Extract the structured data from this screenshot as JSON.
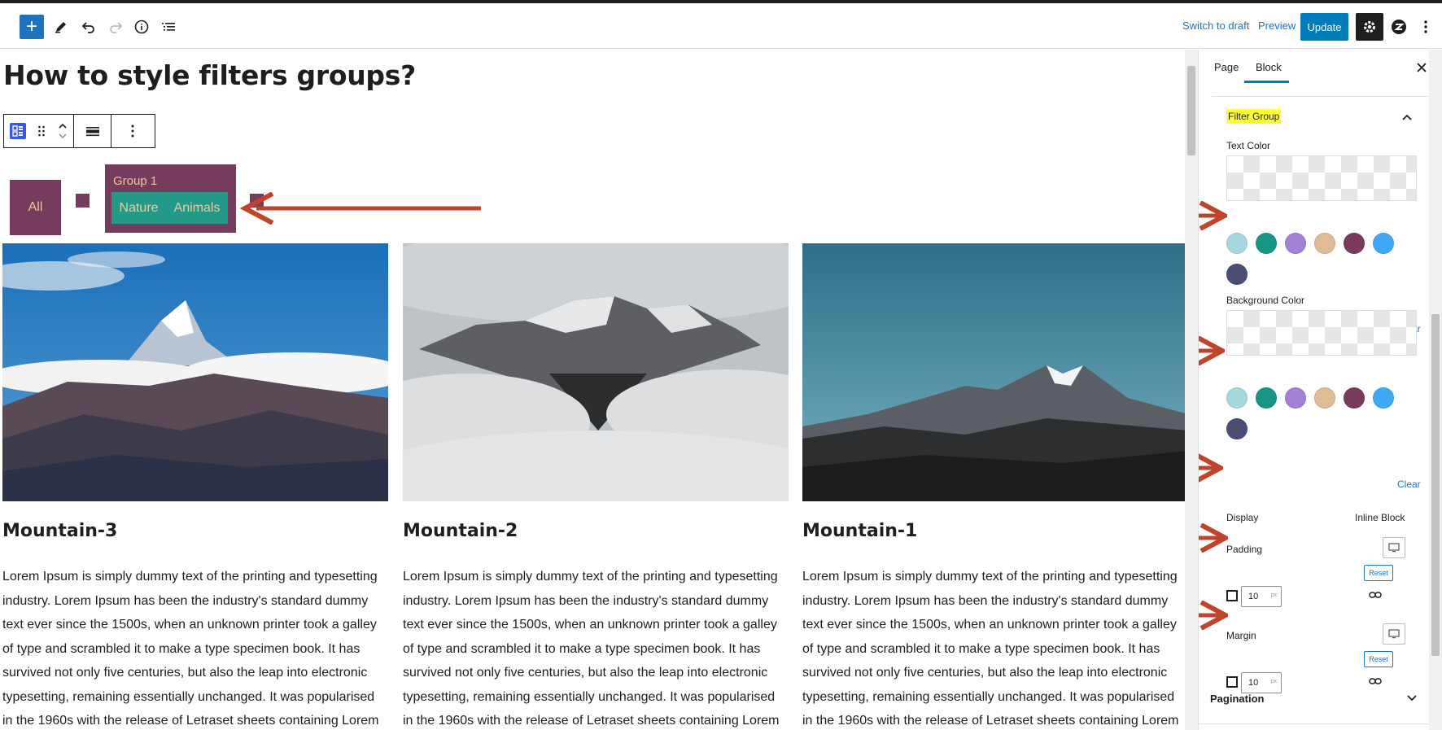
{
  "topbar": {
    "add_label": "+",
    "switch_to_draft": "Switch to draft",
    "preview": "Preview",
    "update": "Update"
  },
  "editor": {
    "page_title": "How to style filters groups?",
    "filters": {
      "all": "All",
      "group_title": "Group 1",
      "items": [
        "Nature",
        "Animals"
      ]
    },
    "cards": [
      {
        "title": "Mountain-3",
        "text": "Lorem Ipsum is simply dummy text of the printing and typesetting industry. Lorem Ipsum has been the industry's standard dummy text ever since the 1500s, when an unknown printer took a galley of type and scrambled it to make a type specimen book. It has survived not only five centuries, but also the leap into electronic typesetting, remaining essentially unchanged. It was popularised in the 1960s with the release of Letraset sheets containing Lorem"
      },
      {
        "title": "Mountain-2",
        "text": "Lorem Ipsum is simply dummy text of the printing and typesetting industry. Lorem Ipsum has been the industry's standard dummy text ever since the 1500s, when an unknown printer took a galley of type and scrambled it to make a type specimen book. It has survived not only five centuries, but also the leap into electronic typesetting, remaining essentially unchanged. It was popularised in the 1960s with the release of Letraset sheets containing Lorem"
      },
      {
        "title": "Mountain-1",
        "text": "Lorem Ipsum is simply dummy text of the printing and typesetting industry. Lorem Ipsum has been the industry's standard dummy text ever since the 1500s, when an unknown printer took a galley of type and scrambled it to make a type specimen book. It has survived not only five centuries, but also the leap into electronic typesetting, remaining essentially unchanged. It was popularised in the 1960s with the release of Letraset sheets containing Lorem"
      }
    ]
  },
  "sidebar": {
    "tabs": [
      "Page",
      "Block"
    ],
    "active_tab": "Block",
    "panel_title": "Filter Group",
    "text_color_label": "Text Color",
    "background_color_label": "Background Color",
    "clear_label": "Clear",
    "palette": [
      "#a7d8df",
      "#179686",
      "#a281d6",
      "#e0bc97",
      "#7a3a5e",
      "#3eaaf5",
      "#4b4d75"
    ],
    "display_label": "Display",
    "display_value": "Inline Block",
    "padding_label": "Padding",
    "padding_value": "10",
    "margin_label": "Margin",
    "margin_value": "10",
    "unit": "px",
    "reset_label": "Reset",
    "pagination_label": "Pagination"
  },
  "colors": {
    "accent": "#007cba",
    "filter_bg": "#763c5e",
    "filter_inner": "#239988",
    "filter_text": "#e9c9a0",
    "arrow": "#c0432b",
    "highlight": "#ffff33"
  }
}
